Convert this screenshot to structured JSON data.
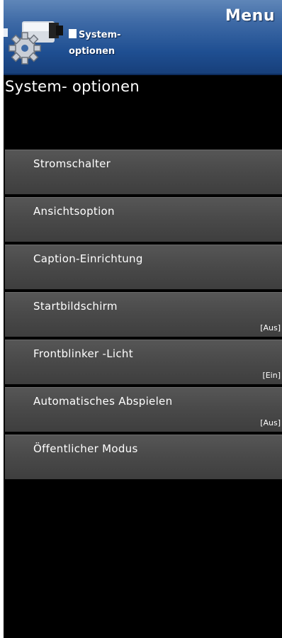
{
  "header": {
    "title": "Menu",
    "section_line1": "System-",
    "section_line2": "optionen"
  },
  "page_title": "System- optionen",
  "menu": {
    "items": [
      {
        "label": "Stromschalter",
        "value": ""
      },
      {
        "label": "Ansichtsoption",
        "value": ""
      },
      {
        "label": "Caption-Einrichtung",
        "value": ""
      },
      {
        "label": "Startbildschirm",
        "value": "[Aus]"
      },
      {
        "label": "Frontblinker -Licht",
        "value": "[Ein]"
      },
      {
        "label": "Automatisches Abspielen",
        "value": "[Aus]"
      },
      {
        "label": "Öffentlicher Modus",
        "value": ""
      }
    ]
  },
  "colors": {
    "header_blue": "#1f4f92",
    "item_gray": "#4a4a4a",
    "background": "#000000",
    "text": "#ffffff"
  },
  "icons": {
    "header": "gear-camera-icon"
  }
}
